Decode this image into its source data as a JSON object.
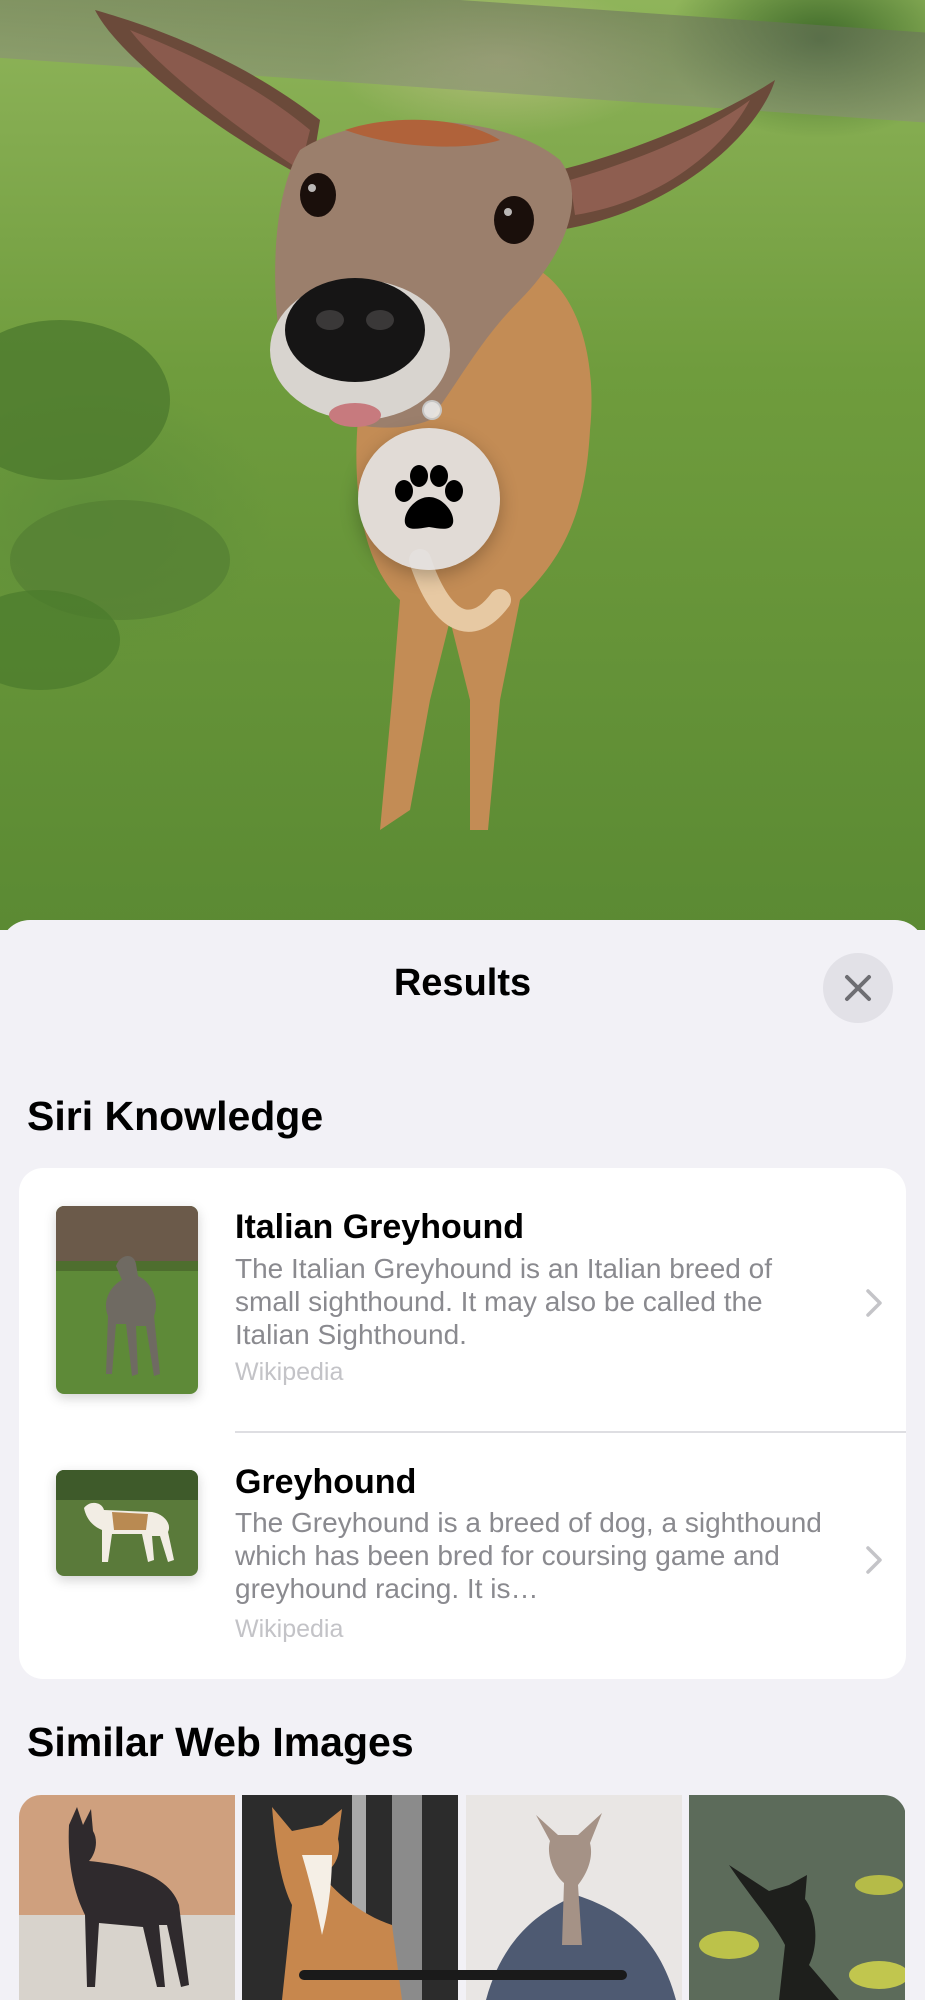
{
  "sheet": {
    "title": "Results"
  },
  "sections": {
    "siri_knowledge": "Siri Knowledge",
    "similar_web_images": "Similar Web Images"
  },
  "results": [
    {
      "title": "Italian Greyhound",
      "description": "The Italian Greyhound is an Italian breed of small sighthound. It may also be called the Italian Sighthound.",
      "source": "Wikipedia"
    },
    {
      "title": "Greyhound",
      "description": "The Greyhound is a breed of dog, a sighthound which has been bred for coursing game and greyhound racing. It is…",
      "source": "Wikipedia"
    }
  ],
  "icons": {
    "lookup": "paw-icon",
    "close": "close-icon",
    "disclosure": "chevron-right-icon"
  },
  "colors": {
    "background": "#f2f1f6",
    "card": "#ffffff",
    "secondary_text": "#8a8a8f",
    "tertiary_text": "#c3c3c7"
  }
}
